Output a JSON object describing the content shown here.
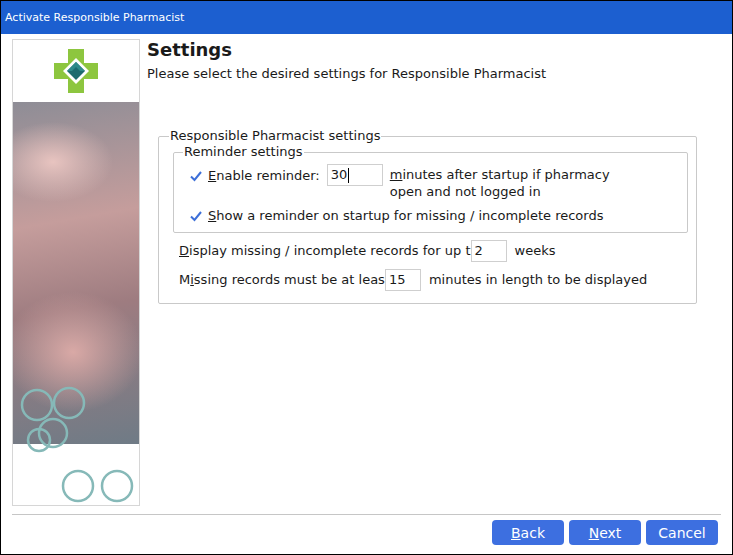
{
  "window": {
    "title": "Activate Responsible Pharmacist"
  },
  "header": {
    "title": "Settings",
    "subtitle": "Please select the desired settings for Responsible Pharmacist"
  },
  "group": {
    "title": "Responsible Pharmacist settings",
    "reminder_group": {
      "title": "Reminder settings",
      "items": [
        {
          "kind": "checkbox-input",
          "label": "Enable reminder:",
          "mnemonic": "E",
          "checked": true,
          "value": "30",
          "focused": true,
          "suffix_lines": [
            "minutes after startup if pharmacy",
            "open and not logged in"
          ],
          "suffix_mnemonic": "m"
        },
        {
          "kind": "checkbox",
          "label": "Show a reminder on startup for missing / incomplete records",
          "mnemonic": "S",
          "checked": true
        }
      ]
    },
    "rows": [
      {
        "prefix": "Display missing / incomplete records for up t",
        "mnemonic": "D",
        "value": "2",
        "focused": false,
        "suffix": "weeks",
        "size": "small"
      },
      {
        "prefix": "Missing records must be at leas",
        "mnemonic": "i",
        "value": "15",
        "focused": false,
        "suffix": "minutes in length to be displayed",
        "size": "small"
      }
    ]
  },
  "buttons": [
    {
      "label": "Back",
      "mnemonic": "B"
    },
    {
      "label": "Next",
      "mnemonic": "N"
    },
    {
      "label": "Cancel",
      "mnemonic": ""
    }
  ]
}
